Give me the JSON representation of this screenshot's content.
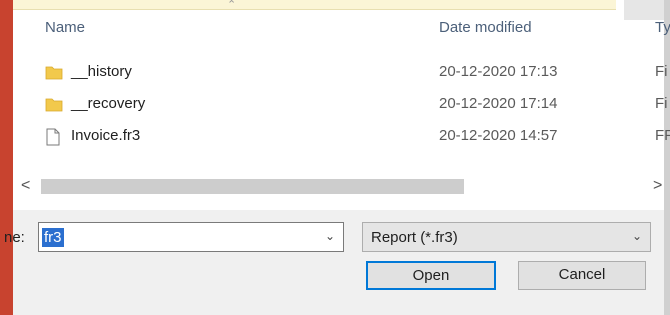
{
  "file_list": {
    "columns": {
      "name": "Name",
      "date_modified": "Date modified",
      "type": "Ty"
    },
    "rows": [
      {
        "name": "__history",
        "date": "20-12-2020 17:13",
        "type": "Fi",
        "icon": "folder-icon"
      },
      {
        "name": "__recovery",
        "date": "20-12-2020 17:14",
        "type": "Fi",
        "icon": "folder-icon"
      },
      {
        "name": "Invoice.fr3",
        "date": "20-12-2020 14:57",
        "type": "FF",
        "icon": "file-icon"
      }
    ]
  },
  "scrollbar": {
    "left_arrow": "<",
    "right_arrow": ">"
  },
  "footer": {
    "file_name_label": "ne:",
    "file_name_value": "fr3",
    "filter_value": "Report (*.fr3)",
    "open_label": "Open",
    "cancel_label": "Cancel"
  },
  "colors": {
    "folder": "#f2c94c",
    "selection": "#2b6fcf",
    "accent_border": "#0078d7",
    "side_strip": "#c8432f"
  }
}
